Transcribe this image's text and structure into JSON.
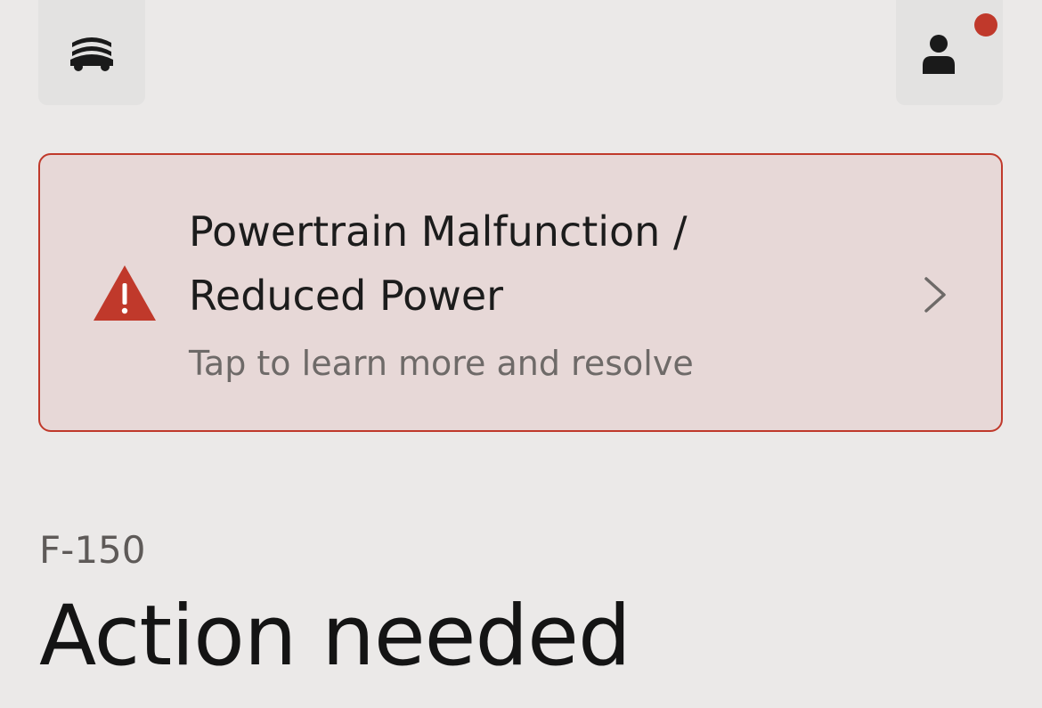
{
  "header": {
    "vehicles_icon": "vehicle-fleet-icon",
    "account_icon": "person-icon",
    "account_has_notification": true
  },
  "alert": {
    "title_line1": "Powertrain Malfunction /",
    "title_line2": "Reduced Power",
    "subtitle": "Tap to learn more and resolve",
    "icon": "warning-triangle-icon",
    "accent_color": "#c0392b"
  },
  "vehicle": {
    "model": "F-150",
    "status": "Action needed"
  }
}
